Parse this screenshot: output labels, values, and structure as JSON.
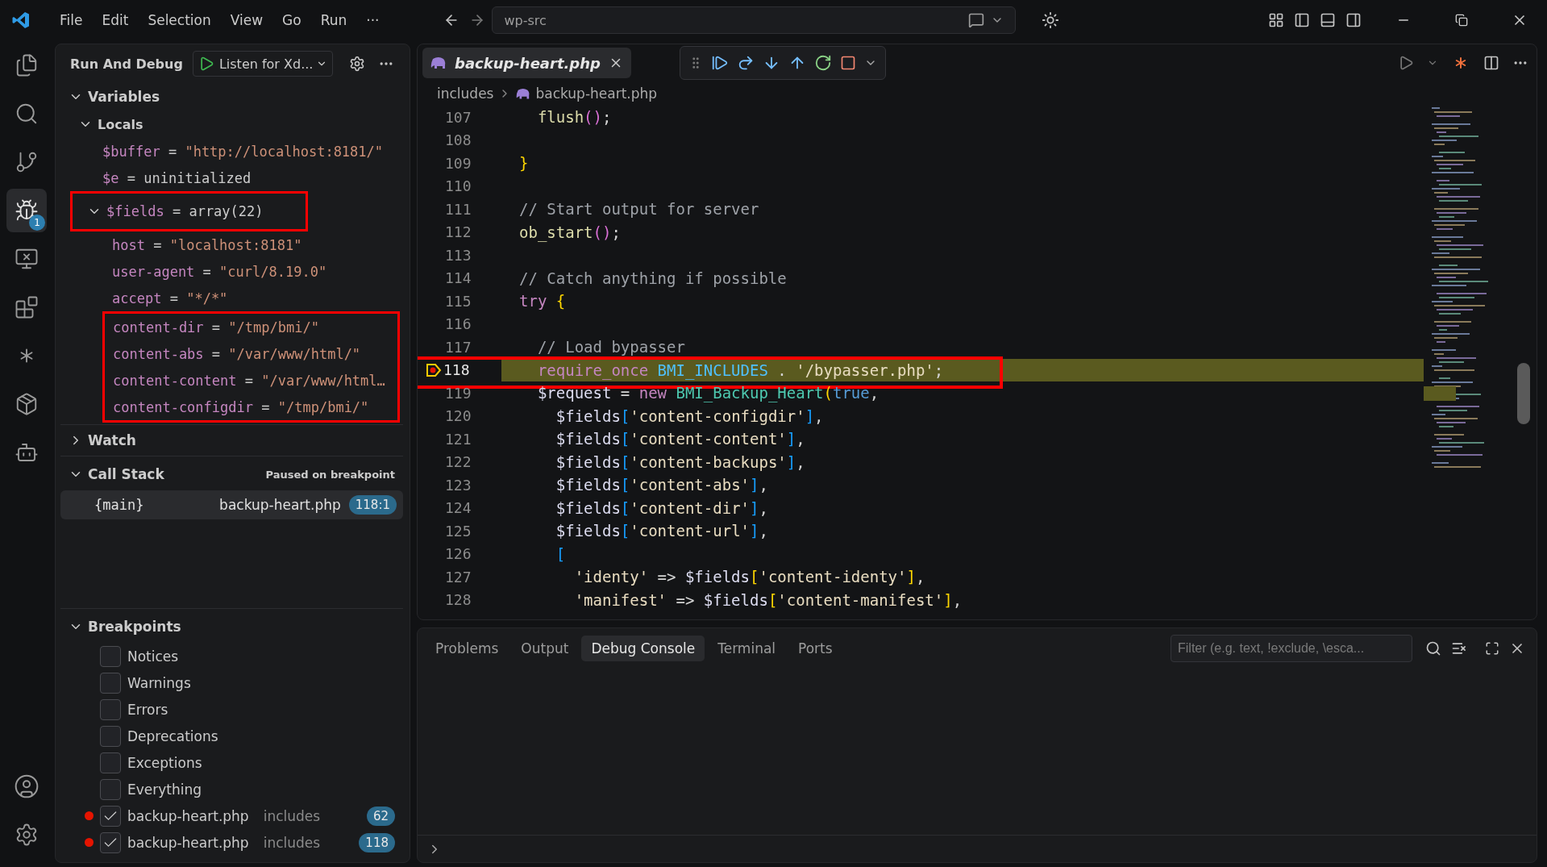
{
  "menu": [
    "File",
    "Edit",
    "Selection",
    "View",
    "Go",
    "Run",
    "···"
  ],
  "command_center": {
    "value": "wp-src"
  },
  "activity_bar": [
    {
      "kind": "files",
      "selected": false
    },
    {
      "kind": "search",
      "selected": false
    },
    {
      "kind": "source-control",
      "selected": false
    },
    {
      "kind": "debug",
      "selected": true,
      "badge": "1"
    },
    {
      "kind": "remote",
      "selected": false
    },
    {
      "kind": "extensions",
      "selected": false
    },
    {
      "kind": "spark",
      "selected": false
    },
    {
      "kind": "package",
      "selected": false
    },
    {
      "kind": "bot",
      "selected": false
    }
  ],
  "side_panel": {
    "title": "Run And Debug",
    "config": "Listen for Xd...",
    "variables": {
      "label": "Variables",
      "expanded": true,
      "scopes": [
        {
          "label": "Locals",
          "expanded": true,
          "children": [
            {
              "name": "$buffer",
              "operator": "=",
              "value": "\"http://localhost:8181/\"",
              "highlighted": false
            },
            {
              "name": "$e",
              "operator": "=",
              "value": "uninitialized",
              "highlighted": false
            },
            {
              "name": "$fields",
              "operator": "=",
              "value": "array(22)",
              "expanded": true,
              "highlighted": true,
              "children": [
                {
                  "name": "host",
                  "operator": "=",
                  "value": "\"localhost:8181\"",
                  "highlighted": false
                },
                {
                  "name": "user-agent",
                  "operator": "=",
                  "value": "\"curl/8.19.0\"",
                  "highlighted": false
                },
                {
                  "name": "accept",
                  "operator": "=",
                  "value": "\"*/*\"",
                  "highlighted": false
                },
                {
                  "name": "content-dir",
                  "operator": "=",
                  "value": "\"/tmp/bmi/\"",
                  "highlighted": true
                },
                {
                  "name": "content-abs",
                  "operator": "=",
                  "value": "\"/var/www/html/\"",
                  "highlighted": true
                },
                {
                  "name": "content-content",
                  "operator": "=",
                  "value": "\"/var/www/html…",
                  "highlighted": true
                },
                {
                  "name": "content-configdir",
                  "operator": "=",
                  "value": "\"/tmp/bmi/\"",
                  "highlighted": true
                }
              ]
            }
          ]
        }
      ]
    },
    "watch": {
      "label": "Watch",
      "expanded": false
    },
    "call_stack": {
      "label": "Call Stack",
      "expanded": true,
      "status": "Paused on breakpoint",
      "frames": [
        {
          "name": "{main}",
          "file": "backup-heart.php",
          "position": "118:1",
          "selected": true
        }
      ]
    },
    "breakpoints": {
      "label": "Breakpoints",
      "expanded": true,
      "items": [
        {
          "kind": "exception",
          "label": "Notices",
          "checked": false
        },
        {
          "kind": "exception",
          "label": "Warnings",
          "checked": false
        },
        {
          "kind": "exception",
          "label": "Errors",
          "checked": false
        },
        {
          "kind": "exception",
          "label": "Deprecations",
          "checked": false
        },
        {
          "kind": "exception",
          "label": "Exceptions",
          "checked": false
        },
        {
          "kind": "exception",
          "label": "Everything",
          "checked": false
        },
        {
          "kind": "file",
          "label": "backup-heart.php",
          "folder": "includes",
          "line": "62",
          "checked": true
        },
        {
          "kind": "file",
          "label": "backup-heart.php",
          "folder": "includes",
          "line": "118",
          "checked": true
        }
      ]
    }
  },
  "editor": {
    "tabs": [
      {
        "label": "backup-heart.php",
        "selected": true
      }
    ],
    "breadcrumb": [
      "includes",
      "backup-heart.php"
    ],
    "lines": [
      {
        "number": "107",
        "current": false,
        "tokens": [
          {
            "text": "  flush",
            "kind": "fn"
          },
          {
            "text": "()",
            "kind": "b2"
          },
          {
            "text": ";",
            "kind": "plain"
          }
        ]
      },
      {
        "number": "108",
        "current": false
      },
      {
        "number": "109",
        "current": false,
        "tokens": [
          {
            "text": "}",
            "kind": "b1"
          }
        ]
      },
      {
        "number": "110",
        "current": false
      },
      {
        "number": "111",
        "current": false,
        "tokens": [
          {
            "text": "// Start output for server",
            "kind": "comment"
          }
        ]
      },
      {
        "number": "112",
        "current": false,
        "tokens": [
          {
            "text": "ob_start",
            "kind": "fn"
          },
          {
            "text": "()",
            "kind": "b2"
          },
          {
            "text": ";",
            "kind": "plain"
          }
        ]
      },
      {
        "number": "113",
        "current": false
      },
      {
        "number": "114",
        "current": false,
        "tokens": [
          {
            "text": "// Catch anything if possible",
            "kind": "comment"
          }
        ]
      },
      {
        "number": "115",
        "current": false,
        "tokens": [
          {
            "text": "try",
            "kind": "kw"
          },
          {
            "text": " {",
            "kind": "b1"
          }
        ]
      },
      {
        "number": "116",
        "current": false
      },
      {
        "number": "117",
        "current": false,
        "tokens": [
          {
            "text": "  // Load bypasser",
            "kind": "comment"
          }
        ]
      },
      {
        "number": "118",
        "current": true,
        "highlighted": true,
        "tokens": [
          {
            "text": "  require_once",
            "kind": "kw"
          },
          {
            "text": " BMI_INCLUDES",
            "kind": "const"
          },
          {
            "text": " . ",
            "kind": "plain"
          },
          {
            "text": "'/bypasser.php'",
            "kind": "str"
          },
          {
            "text": ";",
            "kind": "plain"
          }
        ]
      },
      {
        "number": "119",
        "current": false,
        "tokens": [
          {
            "text": "  $request",
            "kind": "var"
          },
          {
            "text": " = ",
            "kind": "plain"
          },
          {
            "text": "new",
            "kind": "kw"
          },
          {
            "text": " BMI_Backup_Heart",
            "kind": "cls"
          },
          {
            "text": "(",
            "kind": "b1"
          },
          {
            "text": "true",
            "kind": "lit"
          },
          {
            "text": ",",
            "kind": "plain"
          }
        ]
      },
      {
        "number": "120",
        "current": false,
        "tokens": [
          {
            "text": "    $fields",
            "kind": "var"
          },
          {
            "text": "[",
            "kind": "b3"
          },
          {
            "text": "'content-configdir'",
            "kind": "str"
          },
          {
            "text": "]",
            "kind": "b3"
          },
          {
            "text": ",",
            "kind": "plain"
          }
        ]
      },
      {
        "number": "121",
        "current": false,
        "tokens": [
          {
            "text": "    $fields",
            "kind": "var"
          },
          {
            "text": "[",
            "kind": "b3"
          },
          {
            "text": "'content-content'",
            "kind": "str"
          },
          {
            "text": "]",
            "kind": "b3"
          },
          {
            "text": ",",
            "kind": "plain"
          }
        ]
      },
      {
        "number": "122",
        "current": false,
        "tokens": [
          {
            "text": "    $fields",
            "kind": "var"
          },
          {
            "text": "[",
            "kind": "b3"
          },
          {
            "text": "'content-backups'",
            "kind": "str"
          },
          {
            "text": "]",
            "kind": "b3"
          },
          {
            "text": ",",
            "kind": "plain"
          }
        ]
      },
      {
        "number": "123",
        "current": false,
        "tokens": [
          {
            "text": "    $fields",
            "kind": "var"
          },
          {
            "text": "[",
            "kind": "b3"
          },
          {
            "text": "'content-abs'",
            "kind": "str"
          },
          {
            "text": "]",
            "kind": "b3"
          },
          {
            "text": ",",
            "kind": "plain"
          }
        ]
      },
      {
        "number": "124",
        "current": false,
        "tokens": [
          {
            "text": "    $fields",
            "kind": "var"
          },
          {
            "text": "[",
            "kind": "b3"
          },
          {
            "text": "'content-dir'",
            "kind": "str"
          },
          {
            "text": "]",
            "kind": "b3"
          },
          {
            "text": ",",
            "kind": "plain"
          }
        ]
      },
      {
        "number": "125",
        "current": false,
        "tokens": [
          {
            "text": "    $fields",
            "kind": "var"
          },
          {
            "text": "[",
            "kind": "b3"
          },
          {
            "text": "'content-url'",
            "kind": "str"
          },
          {
            "text": "]",
            "kind": "b3"
          },
          {
            "text": ",",
            "kind": "plain"
          }
        ]
      },
      {
        "number": "126",
        "current": false,
        "tokens": [
          {
            "text": "    [",
            "kind": "b3"
          }
        ]
      },
      {
        "number": "127",
        "current": false,
        "tokens": [
          {
            "text": "      'identy'",
            "kind": "str"
          },
          {
            "text": " => ",
            "kind": "plain"
          },
          {
            "text": "$fields",
            "kind": "var"
          },
          {
            "text": "[",
            "kind": "b1"
          },
          {
            "text": "'content-identy'",
            "kind": "str"
          },
          {
            "text": "]",
            "kind": "b1"
          },
          {
            "text": ",",
            "kind": "plain"
          }
        ]
      },
      {
        "number": "128",
        "current": false,
        "tokens": [
          {
            "text": "      'manifest'",
            "kind": "str"
          },
          {
            "text": " => ",
            "kind": "plain"
          },
          {
            "text": "$fields",
            "kind": "var"
          },
          {
            "text": "[",
            "kind": "b1"
          },
          {
            "text": "'content-manifest'",
            "kind": "str"
          },
          {
            "text": "]",
            "kind": "b1"
          },
          {
            "text": ",",
            "kind": "plain"
          }
        ]
      }
    ]
  },
  "panel": {
    "tabs": [
      {
        "label": "Problems",
        "selected": false
      },
      {
        "label": "Output",
        "selected": false
      },
      {
        "label": "Debug Console",
        "selected": true
      },
      {
        "label": "Terminal",
        "selected": false
      },
      {
        "label": "Ports",
        "selected": false
      }
    ],
    "filter": {
      "placeholder": "Filter (e.g. text, !exclude, \\esca..."
    }
  }
}
